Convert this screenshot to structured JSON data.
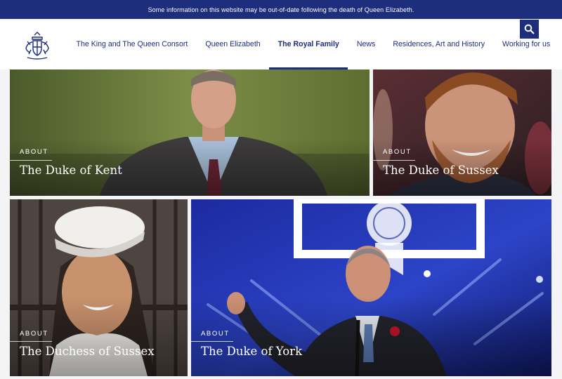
{
  "banner": {
    "text": "Some information on this website may be out-of-date following the death of Queen Elizabeth."
  },
  "header": {
    "logo_icon": "royal-coat-of-arms-icon",
    "search_icon": "search-icon",
    "nav_items": [
      {
        "label": "The King and The Queen Consort",
        "active": false
      },
      {
        "label": "Queen Elizabeth",
        "active": false
      },
      {
        "label": "The Royal Family",
        "active": true
      },
      {
        "label": "News",
        "active": false
      },
      {
        "label": "Residences, Art and History",
        "active": false
      },
      {
        "label": "Working for us",
        "active": false
      }
    ]
  },
  "tiles": [
    {
      "kicker": "About",
      "title": "The Duke of Kent"
    },
    {
      "kicker": "About",
      "title": "The Duke of Sussex"
    },
    {
      "kicker": "About",
      "title": "The Duchess of Sussex"
    },
    {
      "kicker": "About",
      "title": "The Duke of York"
    }
  ],
  "colors": {
    "brand_navy": "#1c2e7c",
    "banner_text": "#ffffff",
    "tile_text": "#ffffff"
  }
}
